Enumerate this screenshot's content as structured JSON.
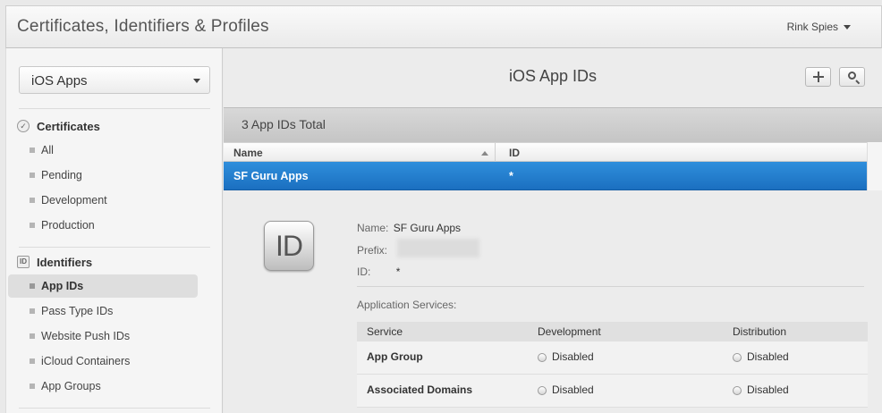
{
  "header": {
    "title": "Certificates, Identifiers & Profiles",
    "user": "Rink Spies"
  },
  "sidebar": {
    "platform": "iOS Apps",
    "certificates": {
      "title": "Certificates",
      "items": [
        "All",
        "Pending",
        "Development",
        "Production"
      ]
    },
    "identifiers": {
      "title": "Identifiers",
      "icon_text": "ID",
      "items": [
        "App IDs",
        "Pass Type IDs",
        "Website Push IDs",
        "iCloud Containers",
        "App Groups"
      ],
      "active": "App IDs"
    }
  },
  "main": {
    "title": "iOS App IDs",
    "total": "3 App IDs Total",
    "columns": {
      "name": "Name",
      "id": "ID"
    },
    "selected": {
      "name": "SF Guru Apps",
      "id": "*"
    },
    "badge_text": "ID",
    "details": {
      "name_label": "Name:",
      "name_value": "SF Guru Apps",
      "prefix_label": "Prefix:",
      "id_label": "ID:",
      "id_value": "*"
    },
    "services_title": "Application Services:",
    "services_columns": {
      "service": "Service",
      "development": "Development",
      "distribution": "Distribution"
    },
    "services": [
      {
        "name": "App Group",
        "development": "Disabled",
        "distribution": "Disabled"
      },
      {
        "name": "Associated Domains",
        "development": "Disabled",
        "distribution": "Disabled"
      }
    ]
  }
}
